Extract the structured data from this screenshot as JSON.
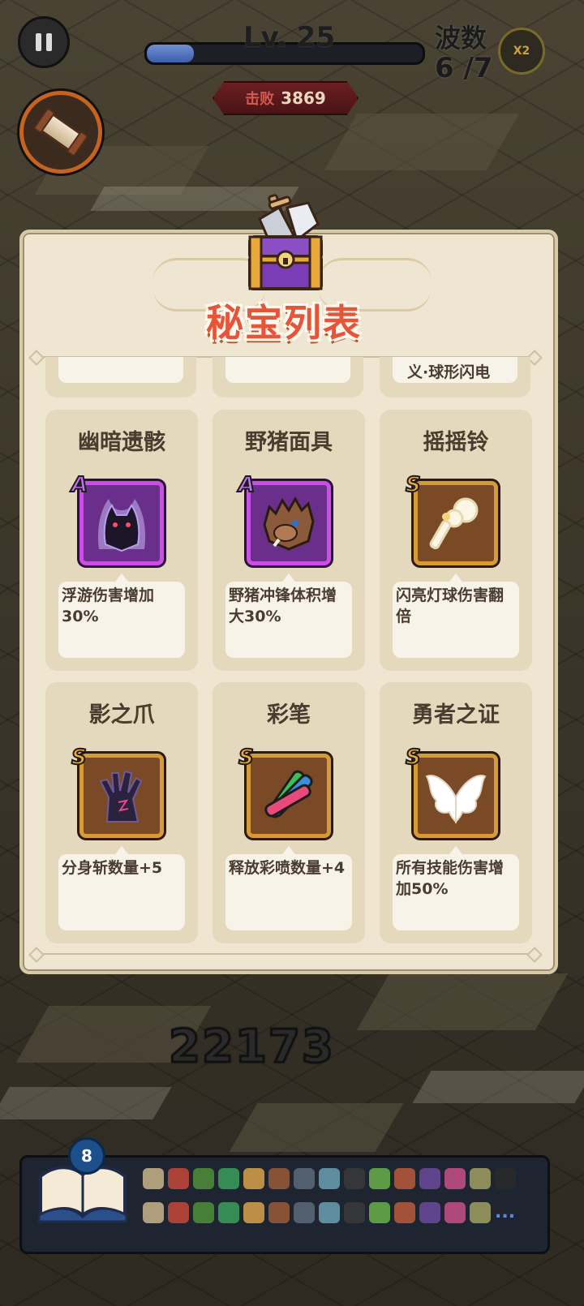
{
  "hud": {
    "level": "Lv. 25",
    "xp_progress": 0.17,
    "wave_label": "波数",
    "wave_value": "6 /7",
    "speed_label": "X2",
    "kills_label": "击败",
    "kills_value": "3869"
  },
  "panel": {
    "title": "秘宝列表",
    "partial_row": [
      "",
      "",
      "义·球形闪电"
    ],
    "items": [
      {
        "name": "幽暗遗骸",
        "rank": "A",
        "icon": "shadow-wolf-icon",
        "desc": "浮游伤害增加30%"
      },
      {
        "name": "野猪面具",
        "rank": "A",
        "icon": "boar-mask-icon",
        "desc": "野猪冲锋体积增大30%"
      },
      {
        "name": "摇摇铃",
        "rank": "S",
        "icon": "rattle-bell-icon",
        "desc": "闪亮灯球伤害翻倍"
      },
      {
        "name": "影之爪",
        "rank": "S",
        "icon": "shadow-claw-icon",
        "desc": "分身斩数量+5"
      },
      {
        "name": "彩笔",
        "rank": "S",
        "icon": "color-pens-icon",
        "desc": "释放彩喷数量+4"
      },
      {
        "name": "勇者之证",
        "rank": "S",
        "icon": "hero-wings-icon",
        "desc": "所有技能伤害增加50%"
      }
    ]
  },
  "damage_number": "22173",
  "skill_bar": {
    "book_count": "8",
    "more": "..."
  },
  "colors": {
    "rank_A": "#c94fe6",
    "rank_S": "#d59a3a",
    "title": "#e6543a",
    "panel_bg": "#efe6d2"
  }
}
